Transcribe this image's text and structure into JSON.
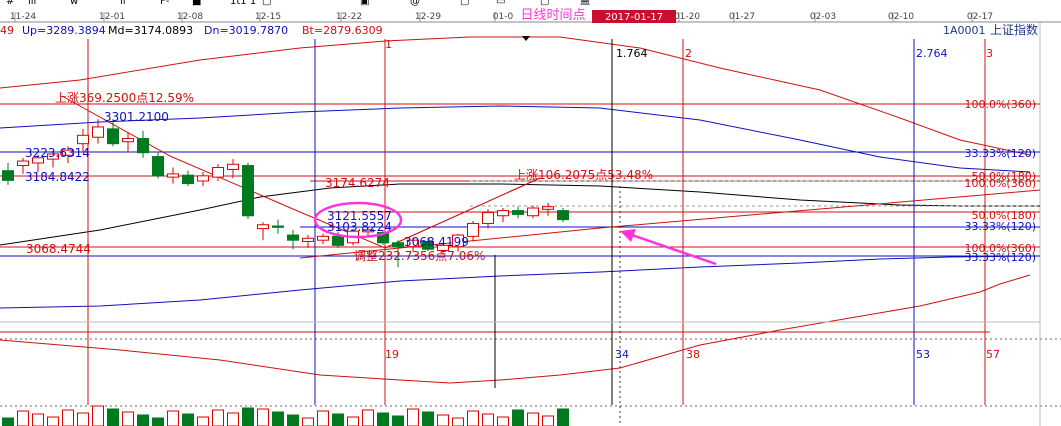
{
  "toolbar": {
    "partial_glyphs": [
      "#",
      "lil",
      "w",
      "ıl",
      "F-",
      "■",
      "1t1 1",
      "▢",
      "▣",
      "@",
      "▢",
      "▭",
      "▢",
      "盖"
    ]
  },
  "axis_dates": [
    "11-24",
    "12-01",
    "12-08",
    "12-15",
    "12-22",
    "12-29",
    "01-0",
    "01-20",
    "01-27",
    "02-03",
    "02-10",
    "02-17"
  ],
  "info_bar": {
    "prefix": "49",
    "up": "Up=3289.3894",
    "md": "Md=3174.0893",
    "dn": "Dn=3019.7870",
    "bt": "Bt=2879.6309",
    "code": "1A0001",
    "name": "上证指数"
  },
  "timing": {
    "label": "日线时间点",
    "date": "2017-01-17"
  },
  "colors": {
    "up": "#e00000",
    "down": "#007a1f",
    "blue": "#1010c0",
    "red": "#d01010",
    "magenta": "#ff33dd",
    "black": "#000000"
  },
  "chart_data": {
    "type": "candlestick",
    "price_range": [
      2960,
      3420
    ],
    "candles": [
      {
        "o": 3220,
        "h": 3232,
        "l": 3198,
        "c": 3205
      },
      {
        "o": 3228,
        "h": 3240,
        "l": 3215,
        "c": 3235
      },
      {
        "o": 3232,
        "h": 3245,
        "l": 3218,
        "c": 3240
      },
      {
        "o": 3238,
        "h": 3250,
        "l": 3225,
        "c": 3246
      },
      {
        "o": 3244,
        "h": 3258,
        "l": 3232,
        "c": 3252
      },
      {
        "o": 3262,
        "h": 3285,
        "l": 3250,
        "c": 3275
      },
      {
        "o": 3272,
        "h": 3300,
        "l": 3262,
        "c": 3288
      },
      {
        "o": 3285,
        "h": 3300,
        "l": 3258,
        "c": 3262
      },
      {
        "o": 3265,
        "h": 3280,
        "l": 3248,
        "c": 3270
      },
      {
        "o": 3270,
        "h": 3282,
        "l": 3240,
        "c": 3248
      },
      {
        "o": 3242,
        "h": 3250,
        "l": 3208,
        "c": 3212
      },
      {
        "o": 3210,
        "h": 3225,
        "l": 3200,
        "c": 3215
      },
      {
        "o": 3213,
        "h": 3220,
        "l": 3196,
        "c": 3200
      },
      {
        "o": 3204,
        "h": 3218,
        "l": 3196,
        "c": 3212
      },
      {
        "o": 3210,
        "h": 3230,
        "l": 3204,
        "c": 3225
      },
      {
        "o": 3222,
        "h": 3238,
        "l": 3208,
        "c": 3230
      },
      {
        "o": 3228,
        "h": 3232,
        "l": 3145,
        "c": 3150
      },
      {
        "o": 3130,
        "h": 3140,
        "l": 3112,
        "c": 3136
      },
      {
        "o": 3134,
        "h": 3144,
        "l": 3122,
        "c": 3132
      },
      {
        "o": 3120,
        "h": 3128,
        "l": 3098,
        "c": 3112
      },
      {
        "o": 3110,
        "h": 3120,
        "l": 3100,
        "c": 3115
      },
      {
        "o": 3112,
        "h": 3122,
        "l": 3106,
        "c": 3118
      },
      {
        "o": 3118,
        "h": 3125,
        "l": 3100,
        "c": 3104
      },
      {
        "o": 3108,
        "h": 3130,
        "l": 3104,
        "c": 3126
      },
      {
        "o": 3125,
        "h": 3132,
        "l": 3118,
        "c": 3128
      },
      {
        "o": 3124,
        "h": 3127,
        "l": 3105,
        "c": 3108
      },
      {
        "o": 3108,
        "h": 3112,
        "l": 3070,
        "c": 3102
      },
      {
        "o": 3102,
        "h": 3116,
        "l": 3094,
        "c": 3112
      },
      {
        "o": 3110,
        "h": 3116,
        "l": 3095,
        "c": 3098
      },
      {
        "o": 3096,
        "h": 3108,
        "l": 3090,
        "c": 3104
      },
      {
        "o": 3102,
        "h": 3122,
        "l": 3094,
        "c": 3120
      },
      {
        "o": 3118,
        "h": 3142,
        "l": 3110,
        "c": 3138
      },
      {
        "o": 3138,
        "h": 3160,
        "l": 3130,
        "c": 3155
      },
      {
        "o": 3150,
        "h": 3162,
        "l": 3140,
        "c": 3158
      },
      {
        "o": 3158,
        "h": 3164,
        "l": 3146,
        "c": 3152
      },
      {
        "o": 3150,
        "h": 3166,
        "l": 3146,
        "c": 3162
      },
      {
        "o": 3160,
        "h": 3170,
        "l": 3150,
        "c": 3164
      },
      {
        "o": 3158,
        "h": 3162,
        "l": 3140,
        "c": 3144
      }
    ],
    "price_labels": [
      {
        "text": "上涨369.2500点12.59%",
        "color": "red"
      },
      {
        "text": "3301.2100",
        "color": "blue"
      },
      {
        "text": "3223.6314",
        "color": "blue"
      },
      {
        "text": "3184.8422",
        "color": "blue"
      },
      {
        "text": "3174.6274",
        "color": "red"
      },
      {
        "text": "上涨106.2075点53.48%",
        "color": "red"
      },
      {
        "text": "3121.5557",
        "color": "blue"
      },
      {
        "text": "3103.8224",
        "color": "blue"
      },
      {
        "text": "3068.4199",
        "color": "blue"
      },
      {
        "text": "3068.4744",
        "color": "red"
      },
      {
        "text": "调整232.7356点7.06%",
        "color": "red"
      }
    ],
    "fib_labels": [
      {
        "text": "100.0%(360)",
        "color": "red"
      },
      {
        "text": "33.33%(120)",
        "color": "blue"
      },
      {
        "text": "50.0%(180)",
        "color": "red"
      },
      {
        "text": "100.0%(360)",
        "color": "red"
      },
      {
        "text": "50.0%(180)",
        "color": "red"
      },
      {
        "text": "33.33%(120)",
        "color": "blue"
      },
      {
        "text": "100.0%(360)",
        "color": "red"
      },
      {
        "text": "33.33%(120)",
        "color": "blue"
      }
    ],
    "time_labels": [
      {
        "text": "1",
        "color": "red"
      },
      {
        "text": "1.764",
        "color": "black"
      },
      {
        "text": "2",
        "color": "red"
      },
      {
        "text": "2.764",
        "color": "blue"
      },
      {
        "text": "3",
        "color": "red"
      },
      {
        "text": "19",
        "color": "red"
      },
      {
        "text": "34",
        "color": "blue"
      },
      {
        "text": "38",
        "color": "red"
      },
      {
        "text": "53",
        "color": "blue"
      },
      {
        "text": "57",
        "color": "red"
      }
    ]
  }
}
